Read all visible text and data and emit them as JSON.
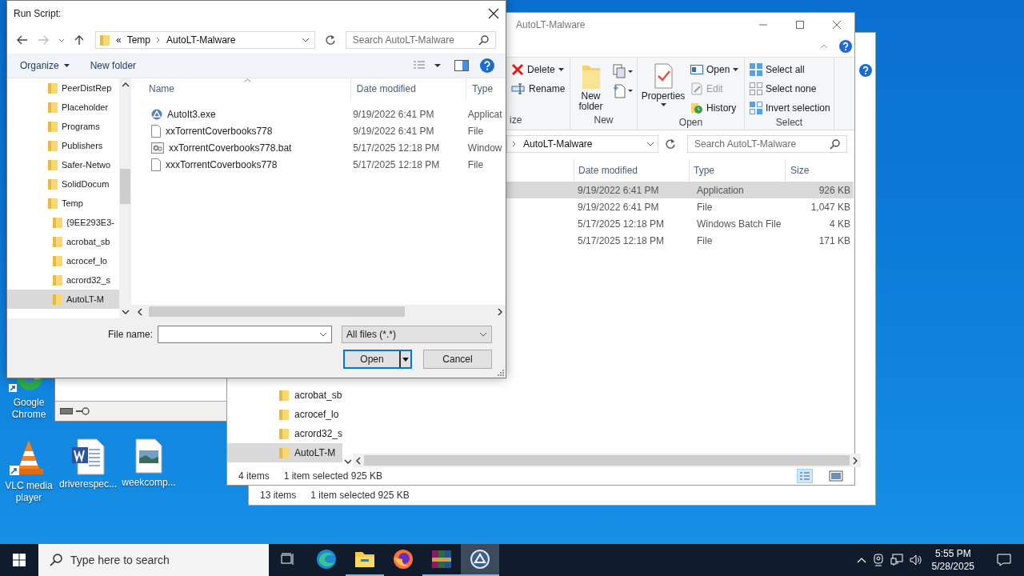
{
  "back_window": {
    "status_items": "13 items",
    "status_selection": "1 item selected  925 KB"
  },
  "desktop_icons": [
    {
      "label": "Google Chrome",
      "kind": "chrome"
    },
    {
      "label": "VLC media player",
      "kind": "vlc"
    },
    {
      "label": "driverespec...",
      "kind": "word"
    },
    {
      "label": "weekcomp...",
      "kind": "image"
    }
  ],
  "explorer": {
    "title": "AutoLT-Malware",
    "ribbon": {
      "organize_label": "ize",
      "delete": "Delete",
      "rename": "Rename",
      "new_folder": "New folder",
      "new_label": "New",
      "properties": "Properties",
      "open_items": [
        {
          "label": "Open",
          "dropdown": true,
          "disabled": false
        },
        {
          "label": "Edit",
          "dropdown": false,
          "disabled": true
        },
        {
          "label": "History",
          "dropdown": false,
          "disabled": false
        }
      ],
      "open_label": "Open",
      "select_items": [
        "Select all",
        "Select none",
        "Invert selection"
      ],
      "select_label": "Select"
    },
    "path": "AutoLT-Malware",
    "search": {
      "placeholder": "Search AutoLT-Malware"
    },
    "columns": [
      "Date modified",
      "Type",
      "Size"
    ],
    "rows": [
      {
        "date": "9/19/2022 6:41 PM",
        "type": "Application",
        "size": "926 KB",
        "selected": true
      },
      {
        "date": "9/19/2022 6:41 PM",
        "type": "File",
        "size": "1,047 KB",
        "selected": false
      },
      {
        "date": "5/17/2025 12:18 PM",
        "type": "Windows Batch File",
        "size": "4 KB",
        "selected": false
      },
      {
        "date": "5/17/2025 12:18 PM",
        "type": "File",
        "size": "171 KB",
        "selected": false
      }
    ],
    "nav_items": [
      {
        "name": "acrobat_sb",
        "selected": false
      },
      {
        "name": "acrocef_lo",
        "selected": false
      },
      {
        "name": "acrord32_s",
        "selected": false
      },
      {
        "name": "AutoLT-M",
        "selected": true
      }
    ],
    "status_items": "4 items",
    "status_selection": "1 item selected  925 KB"
  },
  "dialog": {
    "title": "Run Script:",
    "path_overflow": "«",
    "path": [
      "Temp",
      "AutoLT-Malware"
    ],
    "search": {
      "placeholder": "Search AutoLT-Malware"
    },
    "toolbar": {
      "organize": "Organize",
      "new_folder": "New folder"
    },
    "nav_items": [
      {
        "name": "PeerDistRep",
        "selected": false
      },
      {
        "name": "Placeholder",
        "selected": false
      },
      {
        "name": "Programs",
        "selected": false
      },
      {
        "name": "Publishers",
        "selected": false
      },
      {
        "name": "Safer-Netwo",
        "selected": false
      },
      {
        "name": "SolidDocum",
        "selected": false
      },
      {
        "name": "Temp",
        "selected": false,
        "children": [
          {
            "name": "{9EE293E3-",
            "selected": false
          },
          {
            "name": "acrobat_sb",
            "selected": false
          },
          {
            "name": "acrocef_lo",
            "selected": false
          },
          {
            "name": "acrord32_s",
            "selected": false
          },
          {
            "name": "AutoLT-M",
            "selected": true
          }
        ]
      }
    ],
    "columns": [
      "Name",
      "Date modified",
      "Type"
    ],
    "rows": [
      {
        "name": "AutoIt3.exe",
        "kind": "app",
        "date": "9/19/2022 6:41 PM",
        "type": "Applicat",
        "selected": false
      },
      {
        "name": "xxTorrentCoverbooks778",
        "kind": "file",
        "date": "9/19/2022 6:41 PM",
        "type": "File",
        "selected": false
      },
      {
        "name": "xxTorrentCoverbooks778.bat",
        "kind": "bat",
        "date": "5/17/2025 12:18 PM",
        "type": "Window",
        "selected": false
      },
      {
        "name": "xxxTorrentCoverbooks778",
        "kind": "file",
        "date": "5/17/2025 12:18 PM",
        "type": "File",
        "selected": false
      }
    ],
    "file_name_label": "File name:",
    "filter": "All files (*.*)",
    "open_button": "Open",
    "cancel_button": "Cancel"
  },
  "taskbar": {
    "search_placeholder": "Type here to search",
    "apps": [
      {
        "kind": "edge",
        "running": false,
        "selected": false
      },
      {
        "kind": "explorer",
        "running": true,
        "selected": false
      },
      {
        "kind": "firefox",
        "running": false,
        "selected": false
      },
      {
        "kind": "winrar",
        "running": true,
        "selected": false
      },
      {
        "kind": "autoit",
        "running": true,
        "selected": true
      }
    ],
    "time": "5:55 PM",
    "date": "5/28/2025"
  }
}
